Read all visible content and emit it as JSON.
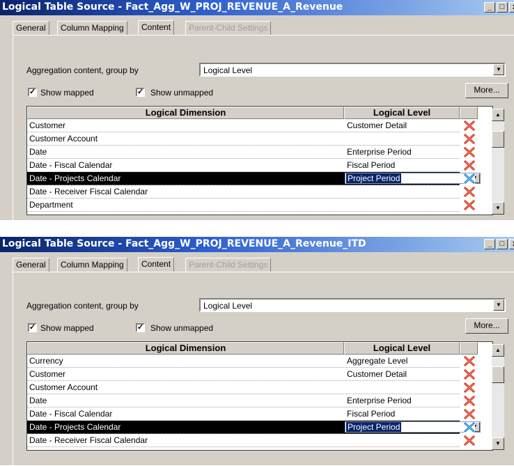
{
  "panels": [
    {
      "title": "Logical Table Source - Fact_Agg_W_PROJ_REVENUE_A_Revenue",
      "tabs": [
        "General",
        "Column Mapping",
        "Content",
        "Parent-Child Settings"
      ],
      "aggregation_label": "Aggregation content, group by",
      "aggregation_value": "Logical Level",
      "show_mapped": "Show mapped",
      "show_unmapped": "Show unmapped",
      "more_button": "More...",
      "col_dimension": "Logical Dimension",
      "col_level": "Logical Level",
      "rows": [
        {
          "dimension": "Customer",
          "level": "Customer Detail"
        },
        {
          "dimension": "Customer Account",
          "level": ""
        },
        {
          "dimension": "Date",
          "level": "Enterprise Period"
        },
        {
          "dimension": "Date - Fiscal Calendar",
          "level": "Fiscal Period"
        },
        {
          "dimension": "Date - Projects Calendar",
          "level": "Project Period",
          "selected": true
        },
        {
          "dimension": "Date - Receiver Fiscal Calendar",
          "level": ""
        },
        {
          "dimension": "Department",
          "level": ""
        }
      ]
    },
    {
      "title": "Logical Table Source - Fact_Agg_W_PROJ_REVENUE_A_Revenue_ITD",
      "tabs": [
        "General",
        "Column Mapping",
        "Content",
        "Parent-Child Settings"
      ],
      "aggregation_label": "Aggregation content, group by",
      "aggregation_value": "Logical Level",
      "show_mapped": "Show mapped",
      "show_unmapped": "Show unmapped",
      "more_button": "More...",
      "col_dimension": "Logical Dimension",
      "col_level": "Logical Level",
      "rows": [
        {
          "dimension": "Currency",
          "level": "Aggregate Level"
        },
        {
          "dimension": "Customer",
          "level": "Customer Detail"
        },
        {
          "dimension": "Customer Account",
          "level": ""
        },
        {
          "dimension": "Date",
          "level": "Enterprise Period"
        },
        {
          "dimension": "Date - Fiscal Calendar",
          "level": "Fiscal Period"
        },
        {
          "dimension": "Date - Projects Calendar",
          "level": "Project Period",
          "selected": true
        },
        {
          "dimension": "Date - Receiver Fiscal Calendar",
          "level": ""
        }
      ]
    }
  ],
  "colors": {
    "titlebar_start": "#0a246a",
    "titlebar_end": "#a6caf0",
    "dialog_bg": "#d4d0c8",
    "delete_red": "#d9381e",
    "delete_blue": "#2a8fd6"
  },
  "icons": {
    "delete": "red-x-icon",
    "delete_selected": "blue-x-icon"
  }
}
